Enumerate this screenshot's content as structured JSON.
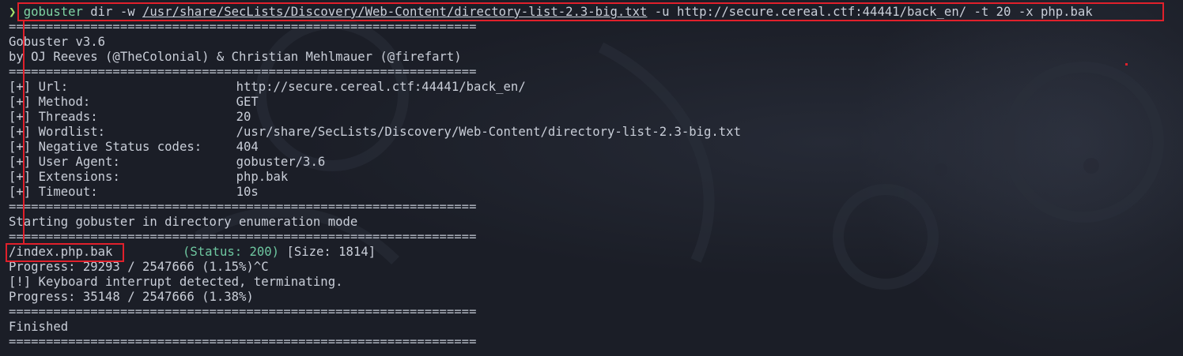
{
  "command": {
    "prompt": "❯",
    "program": "gobuster",
    "pre_path": " dir -w ",
    "wordlist_path": "/usr/share/SecLists/Discovery/Web-Content/directory-list-2.3-big.txt",
    "post_path": " -u http://secure.cereal.ctf:44441/back_en/ -t 20 -x php.bak"
  },
  "separator": "===============================================================",
  "banner": {
    "title": "Gobuster v3.6",
    "authors": "by OJ Reeves (@TheColonial) & Christian Mehlmauer (@firefart)"
  },
  "config": [
    {
      "prefix": "[+]",
      "key": "Url:",
      "value": "http://secure.cereal.ctf:44441/back_en/"
    },
    {
      "prefix": "[+]",
      "key": "Method:",
      "value": "GET"
    },
    {
      "prefix": "[+]",
      "key": "Threads:",
      "value": "20"
    },
    {
      "prefix": "[+]",
      "key": "Wordlist:",
      "value": "/usr/share/SecLists/Discovery/Web-Content/directory-list-2.3-big.txt"
    },
    {
      "prefix": "[+]",
      "key": "Negative Status codes:",
      "value": "404"
    },
    {
      "prefix": "[+]",
      "key": "User Agent:",
      "value": "gobuster/3.6"
    },
    {
      "prefix": "[+]",
      "key": "Extensions:",
      "value": "php.bak"
    },
    {
      "prefix": "[+]",
      "key": "Timeout:",
      "value": "10s"
    }
  ],
  "mode_line": "Starting gobuster in directory enumeration mode",
  "result": {
    "path": "/index.php.bak",
    "status": "(Status: 200)",
    "size": " [Size: 1814]"
  },
  "progress_lines": [
    "Progress: 29293 / 2547666 (1.15%)^C",
    "[!] Keyboard interrupt detected, terminating.",
    "Progress: 35148 / 2547666 (1.38%)"
  ],
  "finished": "Finished",
  "colors": {
    "background": "#1b1e27",
    "text": "#c9ced8",
    "prompt": "#a6e36a",
    "command": "#7fd4a4",
    "status": "#6ec7a0",
    "highlight": "#e0202b"
  }
}
